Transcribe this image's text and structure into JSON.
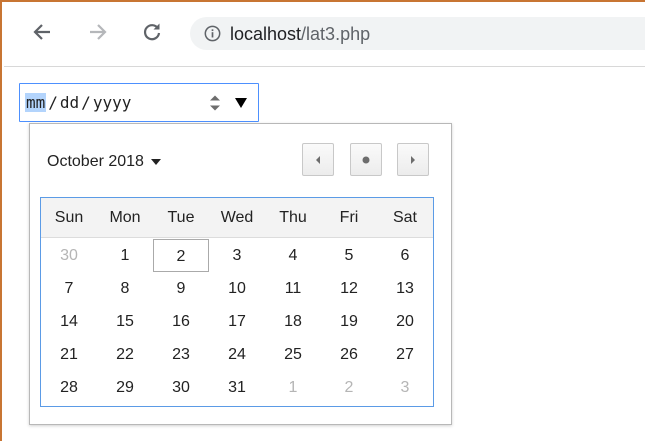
{
  "browser": {
    "url_host": "localhost",
    "url_path": "/lat3.php"
  },
  "date_input": {
    "month_placeholder": "mm",
    "day_placeholder": "dd",
    "year_placeholder": "yyyy",
    "separator": "/"
  },
  "calendar": {
    "month_label": "October 2018",
    "weekdays": [
      "Sun",
      "Mon",
      "Tue",
      "Wed",
      "Thu",
      "Fri",
      "Sat"
    ],
    "today": "2",
    "weeks": [
      [
        "30",
        "1",
        "2",
        "3",
        "4",
        "5",
        "6"
      ],
      [
        "7",
        "8",
        "9",
        "10",
        "11",
        "12",
        "13"
      ],
      [
        "14",
        "15",
        "16",
        "17",
        "18",
        "19",
        "20"
      ],
      [
        "21",
        "22",
        "23",
        "24",
        "25",
        "26",
        "27"
      ],
      [
        "28",
        "29",
        "30",
        "31",
        "1",
        "2",
        "3"
      ]
    ],
    "dim_cells": [
      [
        0,
        0
      ],
      [
        4,
        4
      ],
      [
        4,
        5
      ],
      [
        4,
        6
      ]
    ]
  },
  "colors": {
    "focus_border": "#4d90fe",
    "grid_border": "#5b9be6",
    "selection_highlight": "#b3d4fc",
    "window_border": "#c87533"
  }
}
